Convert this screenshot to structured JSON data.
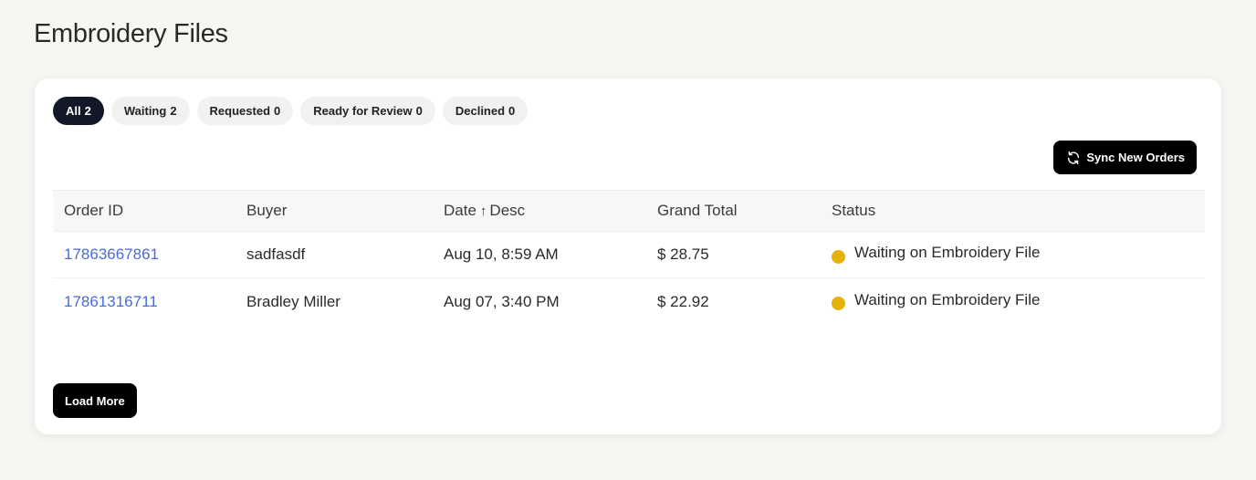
{
  "page": {
    "title": "Embroidery Files"
  },
  "filters": [
    {
      "label": "All",
      "count": "2",
      "active": true
    },
    {
      "label": "Waiting",
      "count": "2",
      "active": false
    },
    {
      "label": "Requested",
      "count": "0",
      "active": false
    },
    {
      "label": "Ready for Review",
      "count": "0",
      "active": false
    },
    {
      "label": "Declined",
      "count": "0",
      "active": false
    }
  ],
  "toolbar": {
    "sync_label": "Sync New Orders",
    "sync_icon": "refresh-icon"
  },
  "table": {
    "columns": {
      "order_id": "Order ID",
      "buyer": "Buyer",
      "date": "Date",
      "date_sort_icon": "↑",
      "date_sort": "Desc",
      "grand_total": "Grand Total",
      "status": "Status"
    },
    "rows": [
      {
        "order_id": "17863667861",
        "buyer": "sadfasdf",
        "date": "Aug 10, 8:59 AM",
        "grand_total": "$ 28.75",
        "status": "Waiting on Embroidery File"
      },
      {
        "order_id": "17861316711",
        "buyer": "Bradley Miller",
        "date": "Aug 07, 3:40 PM",
        "grand_total": "$ 22.92",
        "status": "Waiting on Embroidery File"
      }
    ]
  },
  "footer": {
    "load_more_label": "Load More"
  },
  "colors": {
    "page_bg": "#f7f6f2",
    "active_chip": "#111827",
    "link": "#4a6bd8",
    "status_waiting": "#e5b20a"
  }
}
